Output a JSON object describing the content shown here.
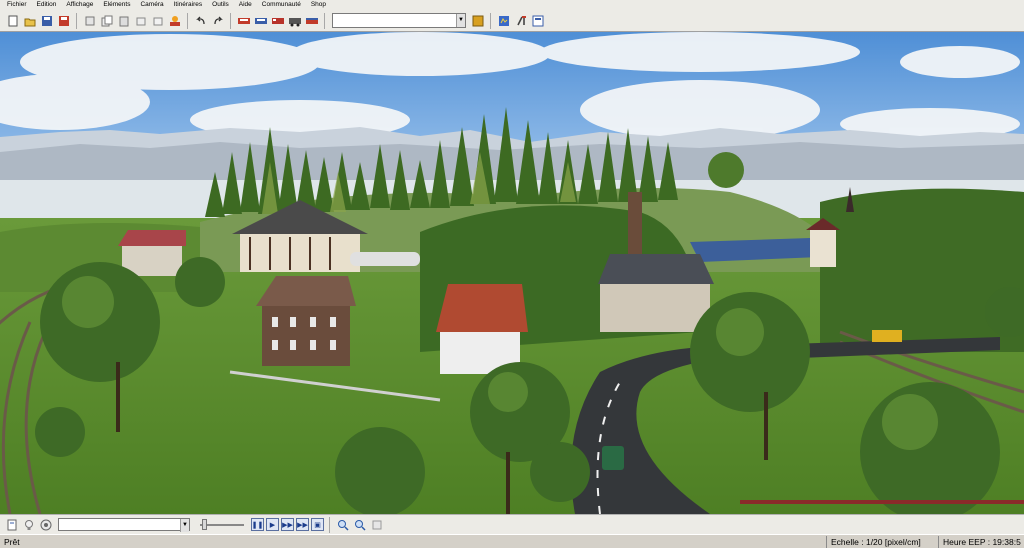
{
  "menu": [
    "Fichier",
    "Edition",
    "Affichage",
    "Eléments",
    "Caméra",
    "Itinéraires",
    "Outils",
    "Aide",
    "Communauté",
    "Shop"
  ],
  "toolbar": {
    "icons_left": [
      "new-file-icon",
      "open-folder-icon",
      "save-icon",
      "save-all-icon",
      "cut-icon",
      "copy-icon",
      "paste-icon",
      "duplicate-icon",
      "delete-icon",
      "fire-icon"
    ],
    "icons_history": [
      "undo-icon",
      "redo-icon"
    ],
    "icons_edit": [
      "train-red-icon",
      "train-blue-icon",
      "train-red-2-icon",
      "locomotive-icon",
      "wagon-icon"
    ],
    "icons_right": [
      "landscape-icon",
      "settings-icon",
      "tools-icon",
      "layout-icon"
    ]
  },
  "bottombar": {
    "icons": [
      "notes-icon",
      "light-bulb-icon",
      "camera-rotate-icon"
    ],
    "playback": [
      "pause-icon",
      "play-icon",
      "fast-forward-icon",
      "fastest-forward-icon",
      "screen-capture-icon"
    ],
    "zoom": [
      "zoom-in-icon",
      "zoom-out-icon",
      "grid-icon"
    ]
  },
  "status": {
    "left": "Prêt",
    "scale": "Echelle : 1/20 [pixel/cm]",
    "time": "Heure EEP : 19:38:5"
  },
  "colors": {
    "sky": "#6fa8dc",
    "grass": "#5e8f2e",
    "forest": "#3f6b25",
    "road": "#34373a",
    "roof_red": "#b04a31",
    "chrome": "#ecebe6"
  }
}
